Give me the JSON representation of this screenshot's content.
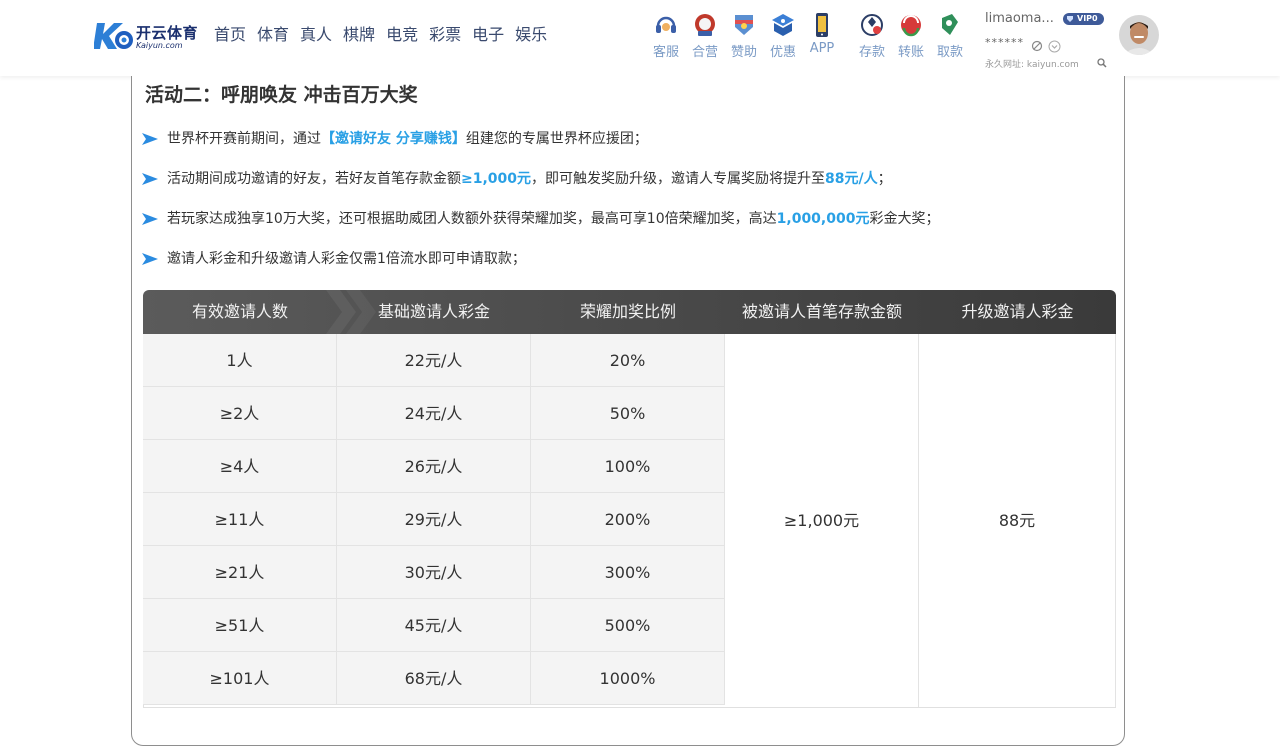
{
  "header": {
    "logo": {
      "name": "开云体育",
      "sub": "Kaiyun.com"
    },
    "nav": [
      "首页",
      "体育",
      "真人",
      "棋牌",
      "电竞",
      "彩票",
      "电子",
      "娱乐"
    ],
    "tools": [
      {
        "label": "客服",
        "icon": "headset-icon"
      },
      {
        "label": "合营",
        "icon": "partnership-icon"
      },
      {
        "label": "赞助",
        "icon": "sponsor-icon"
      },
      {
        "label": "优惠",
        "icon": "promotion-icon"
      },
      {
        "label": "APP",
        "icon": "phone-app-icon"
      },
      {
        "label": "存款",
        "icon": "deposit-icon"
      },
      {
        "label": "转账",
        "icon": "transfer-icon"
      },
      {
        "label": "取款",
        "icon": "withdraw-icon"
      }
    ],
    "user": {
      "name": "limaoma...",
      "vip": "VIP0",
      "password_mask": "******",
      "permanent_url": "永久网址: kaiyun.com"
    }
  },
  "activity": {
    "title": "活动二：呼朋唤友 冲击百万大奖",
    "rules": [
      {
        "parts": [
          {
            "t": "世界杯开赛前期间，通过"
          },
          {
            "t": "【邀请好友 分享赚钱】",
            "hl": true
          },
          {
            "t": "组建您的专属世界杯应援团；"
          }
        ]
      },
      {
        "parts": [
          {
            "t": "活动期间成功邀请的好友，若好友首笔存款金额"
          },
          {
            "t": "≥1,000元",
            "hl": true
          },
          {
            "t": "，即可触发奖励升级，邀请人专属奖励将提升至"
          },
          {
            "t": "88元/人",
            "hl": true
          },
          {
            "t": "；"
          }
        ]
      },
      {
        "parts": [
          {
            "t": "若玩家达成独享10万大奖，还可根据助威团人数额外获得荣耀加奖，最高可享10倍荣耀加奖，高达"
          },
          {
            "t": "1,000,000元",
            "hl": true
          },
          {
            "t": "彩金大奖；"
          }
        ]
      },
      {
        "parts": [
          {
            "t": "邀请人彩金和升级邀请人彩金仅需1倍流水即可申请取款；"
          }
        ]
      }
    ],
    "table": {
      "headers": [
        "有效邀请人数",
        "基础邀请人彩金",
        "荣耀加奖比例",
        "被邀请人首笔存款金额",
        "升级邀请人彩金"
      ],
      "rows": [
        [
          "1人",
          "22元/人",
          "20%"
        ],
        [
          "≥2人",
          "24元/人",
          "50%"
        ],
        [
          "≥4人",
          "26元/人",
          "100%"
        ],
        [
          "≥11人",
          "29元/人",
          "200%"
        ],
        [
          "≥21人",
          "30元/人",
          "300%"
        ],
        [
          "≥51人",
          "45元/人",
          "500%"
        ],
        [
          "≥101人",
          "68元/人",
          "1000%"
        ]
      ],
      "merged": [
        "≥1,000元",
        "88元"
      ]
    }
  },
  "colors": {
    "highlight": "#29a0e5",
    "nav_text": "#3a4a6e",
    "tool_label": "#7a9ac5",
    "table_header": "#4c4c4c"
  }
}
